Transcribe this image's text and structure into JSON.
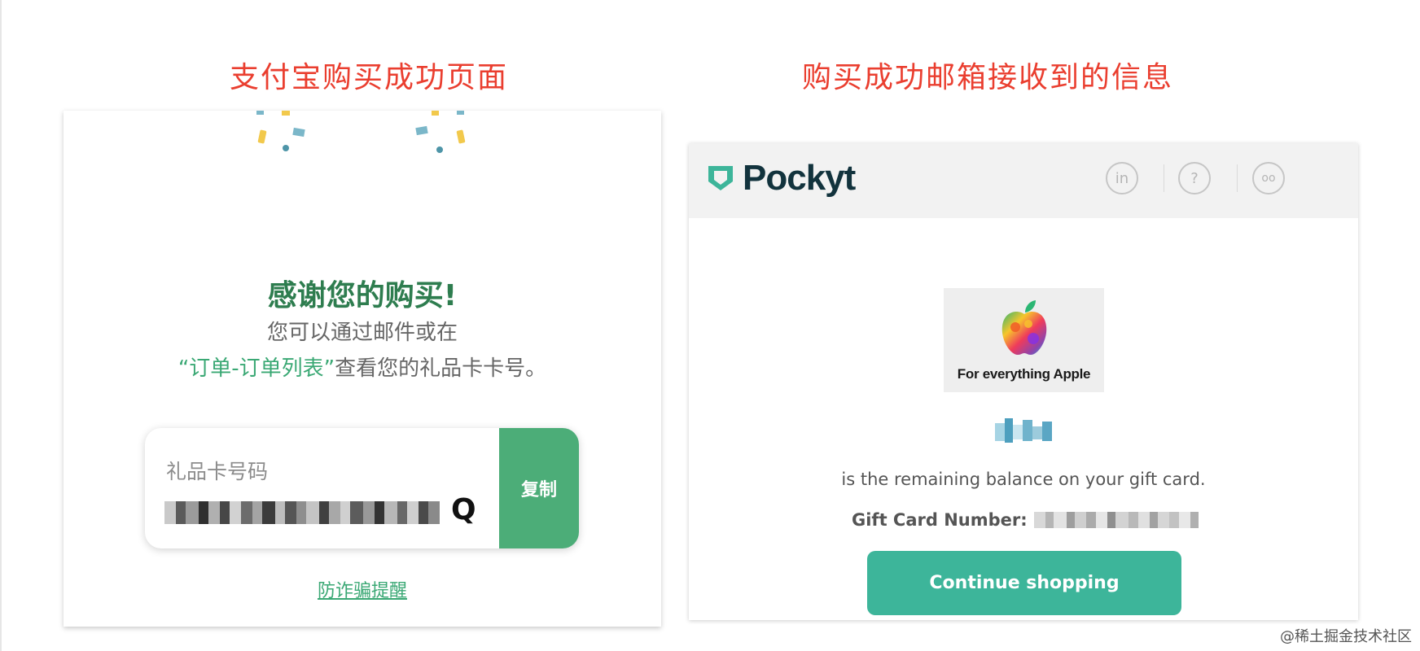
{
  "captions": {
    "left": "支付宝购买成功页面",
    "right": "购买成功邮箱接收到的信息"
  },
  "alipay": {
    "thanks_title": "感谢您的购买!",
    "line1": "您可以通过邮件或在",
    "order_link": "“订单-订单列表”",
    "line2_rest": "查看您的礼品卡卡号。",
    "card_label": "礼品卡号码",
    "card_number_visible_tail": "Q",
    "copy_button": "复制",
    "fraud_link": "防诈骗提醒",
    "accent_color": "#4cad78"
  },
  "pockyt": {
    "logo_text": "Pockyt",
    "header_icons": [
      "linkedin-icon",
      "help-icon",
      "glasses-icon"
    ],
    "header_icon_glyphs": [
      "in",
      "?",
      "oo"
    ],
    "apple_tagline": "For everything Apple",
    "balance_text": "is the remaining balance on your gift card.",
    "gift_card_label": "Gift Card Number:",
    "continue_button": "Continue shopping",
    "button_color": "#3db59a"
  },
  "watermark": "@稀土掘金技术社区"
}
